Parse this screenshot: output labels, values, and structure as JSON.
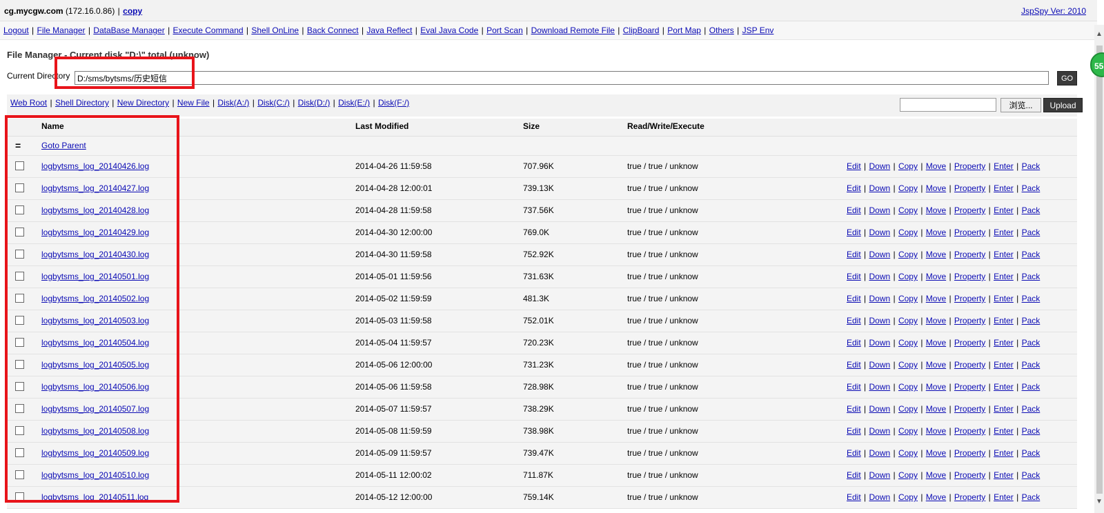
{
  "header": {
    "host": "cg.mycgw.com",
    "ip": "(172.16.0.86)",
    "copy_link": "copy",
    "version_link": "JspSpy Ver: 2010"
  },
  "nav": {
    "items": [
      "Logout",
      "File Manager",
      "DataBase Manager",
      "Execute Command",
      "Shell OnLine",
      "Back Connect",
      "Java Reflect",
      "Eval Java Code",
      "Port Scan",
      "Download Remote File",
      "ClipBoard",
      "Port Map",
      "Others",
      "JSP Env"
    ]
  },
  "file_manager": {
    "title": "File Manager - Current disk \"D:\\\" total (unknow)",
    "current_dir_label": "Current Directory",
    "current_dir_value": "D:/sms/bytsms/历史短信",
    "go_label": "GO",
    "links": [
      "Web Root",
      "Shell Directory",
      "New Directory",
      "New File",
      "Disk(A:/)",
      "Disk(C:/)",
      "Disk(D:/)",
      "Disk(E:/)",
      "Disk(F:/)"
    ],
    "browse_label": "浏览...",
    "upload_label": "Upload"
  },
  "table": {
    "headers": {
      "name": "Name",
      "modified": "Last Modified",
      "size": "Size",
      "rwx": "Read/Write/Execute"
    },
    "parent_symbol": "=",
    "parent_label": "Goto Parent",
    "actions": [
      "Edit",
      "Down",
      "Copy",
      "Move",
      "Property",
      "Enter",
      "Pack"
    ],
    "rows": [
      {
        "name": "logbytsms_log_20140426.log",
        "modified": "2014-04-26 11:59:58",
        "size": "707.96K",
        "rwx": "true / true / unknow"
      },
      {
        "name": "logbytsms_log_20140427.log",
        "modified": "2014-04-28 12:00:01",
        "size": "739.13K",
        "rwx": "true / true / unknow"
      },
      {
        "name": "logbytsms_log_20140428.log",
        "modified": "2014-04-28 11:59:58",
        "size": "737.56K",
        "rwx": "true / true / unknow"
      },
      {
        "name": "logbytsms_log_20140429.log",
        "modified": "2014-04-30 12:00:00",
        "size": "769.0K",
        "rwx": "true / true / unknow"
      },
      {
        "name": "logbytsms_log_20140430.log",
        "modified": "2014-04-30 11:59:58",
        "size": "752.92K",
        "rwx": "true / true / unknow"
      },
      {
        "name": "logbytsms_log_20140501.log",
        "modified": "2014-05-01 11:59:56",
        "size": "731.63K",
        "rwx": "true / true / unknow"
      },
      {
        "name": "logbytsms_log_20140502.log",
        "modified": "2014-05-02 11:59:59",
        "size": "481.3K",
        "rwx": "true / true / unknow"
      },
      {
        "name": "logbytsms_log_20140503.log",
        "modified": "2014-05-03 11:59:58",
        "size": "752.01K",
        "rwx": "true / true / unknow"
      },
      {
        "name": "logbytsms_log_20140504.log",
        "modified": "2014-05-04 11:59:57",
        "size": "720.23K",
        "rwx": "true / true / unknow"
      },
      {
        "name": "logbytsms_log_20140505.log",
        "modified": "2014-05-06 12:00:00",
        "size": "731.23K",
        "rwx": "true / true / unknow"
      },
      {
        "name": "logbytsms_log_20140506.log",
        "modified": "2014-05-06 11:59:58",
        "size": "728.98K",
        "rwx": "true / true / unknow"
      },
      {
        "name": "logbytsms_log_20140507.log",
        "modified": "2014-05-07 11:59:57",
        "size": "738.29K",
        "rwx": "true / true / unknow"
      },
      {
        "name": "logbytsms_log_20140508.log",
        "modified": "2014-05-08 11:59:59",
        "size": "738.98K",
        "rwx": "true / true / unknow"
      },
      {
        "name": "logbytsms_log_20140509.log",
        "modified": "2014-05-09 11:59:57",
        "size": "739.47K",
        "rwx": "true / true / unknow"
      },
      {
        "name": "logbytsms_log_20140510.log",
        "modified": "2014-05-11 12:00:02",
        "size": "711.87K",
        "rwx": "true / true / unknow"
      },
      {
        "name": "logbytsms_log_20140511.log",
        "modified": "2014-05-12 12:00:00",
        "size": "759.14K",
        "rwx": "true / true / unknow"
      }
    ]
  },
  "overlay": {
    "bubble_text": "55",
    "highlight_color": "#e8141a"
  }
}
